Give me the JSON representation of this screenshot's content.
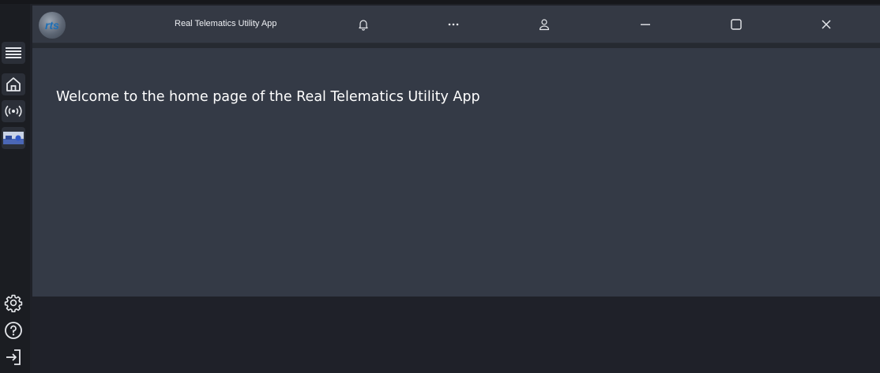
{
  "window": {
    "title": "Real Telematics Utility App",
    "logo_text": "rts"
  },
  "titlebar": {
    "icons": [
      "bell-icon",
      "more-icon",
      "user-icon",
      "minimize-icon",
      "maximize-icon",
      "close-icon"
    ]
  },
  "sidebar": {
    "items": [
      {
        "icon": "menu-icon"
      },
      {
        "icon": "home-icon"
      },
      {
        "icon": "broadcast-icon"
      },
      {
        "icon": "image-thumbnail-icon"
      },
      {
        "icon": "settings-gear-icon"
      },
      {
        "icon": "help-icon"
      },
      {
        "icon": "logout-icon"
      }
    ]
  },
  "main": {
    "welcome_text": "Welcome to the home page of the Real Telematics Utility App"
  }
}
